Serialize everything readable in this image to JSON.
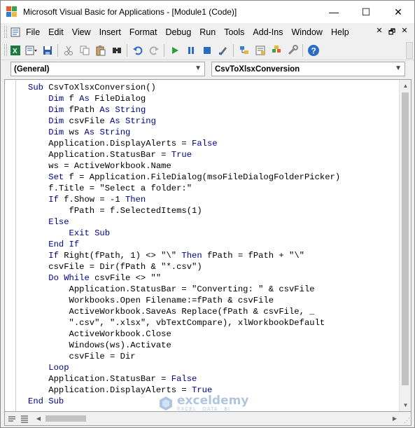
{
  "window": {
    "title": "Microsoft Visual Basic for Applications - [Module1 (Code)]",
    "controls": {
      "minimize": "—",
      "maximize": "☐",
      "close": "✕"
    }
  },
  "menubar": {
    "items": [
      "File",
      "Edit",
      "View",
      "Insert",
      "Format",
      "Debug",
      "Run",
      "Tools",
      "Add-Ins",
      "Window",
      "Help"
    ],
    "mdi_controls": {
      "minimize": "✕",
      "restore": "🗗",
      "close": "✕"
    }
  },
  "toolbar": {
    "icons": [
      "view-excel-icon",
      "insert-module-icon",
      "save-icon",
      "cut-icon",
      "copy-icon",
      "paste-icon",
      "find-icon",
      "undo-icon",
      "redo-icon",
      "run-icon",
      "break-icon",
      "reset-icon",
      "design-mode-icon",
      "project-explorer-icon",
      "properties-icon",
      "object-browser-icon",
      "toolbox-icon",
      "help-icon"
    ]
  },
  "combos": {
    "object": "(General)",
    "procedure": "CsvToXlsxConversion"
  },
  "code_lines": [
    [
      "Sub",
      " CsvToXlsxConversion()"
    ],
    [
      "    Dim",
      " f ",
      "As",
      " FileDialog"
    ],
    [
      "    Dim",
      " fPath ",
      "As",
      " ",
      "String"
    ],
    [
      "    Dim",
      " csvFile ",
      "As",
      " ",
      "String"
    ],
    [
      "    Dim",
      " ws ",
      "As",
      " ",
      "String"
    ],
    [
      "    Application.DisplayAlerts = ",
      "False"
    ],
    [
      "    Application.StatusBar = ",
      "True"
    ],
    [
      "    ws = ActiveWorkbook.Name"
    ],
    [
      "    Set",
      " f = Application.FileDialog(msoFileDialogFolderPicker)"
    ],
    [
      "    f.Title = \"Select a folder:\""
    ],
    [
      "    If",
      " f.Show = -1 ",
      "Then"
    ],
    [
      "        fPath = f.SelectedItems(1)"
    ],
    [
      "    Else"
    ],
    [
      "        Exit",
      " ",
      "Sub"
    ],
    [
      "    End",
      " ",
      "If"
    ],
    [
      "    If",
      " Right(fPath, 1) <> \"\\\" ",
      "Then",
      " fPath = fPath + \"\\\""
    ],
    [
      "    csvFile = Dir(fPath & \"*.csv\")"
    ],
    [
      "    Do",
      " ",
      "While",
      " csvFile <> \"\""
    ],
    [
      "        Application.StatusBar = \"Converting: \" & csvFile"
    ],
    [
      "        Workbooks.Open Filename:=fPath & csvFile"
    ],
    [
      "        ActiveWorkbook.SaveAs Replace(fPath & csvFile, _"
    ],
    [
      "        \".csv\", \".xlsx\", vbTextCompare), xlWorkbookDefault"
    ],
    [
      "        ActiveWorkbook.Close"
    ],
    [
      "        Windows(ws).Activate"
    ],
    [
      "        csvFile = Dir"
    ],
    [
      "    Loop"
    ],
    [
      "    Application.StatusBar = ",
      "False"
    ],
    [
      "    Application.DisplayAlerts = ",
      "True"
    ],
    [
      "End",
      " ",
      "Sub"
    ]
  ],
  "keywords": [
    "Sub",
    "Dim",
    "As",
    "String",
    "False",
    "True",
    "Set",
    "If",
    "Then",
    "Else",
    "Exit",
    "End",
    "Do",
    "While",
    "Loop"
  ],
  "colors": {
    "keyword": "#00008b",
    "text": "#000000"
  },
  "watermark": {
    "name": "exceldemy",
    "tagline": "EXCEL · DATA · BI"
  }
}
